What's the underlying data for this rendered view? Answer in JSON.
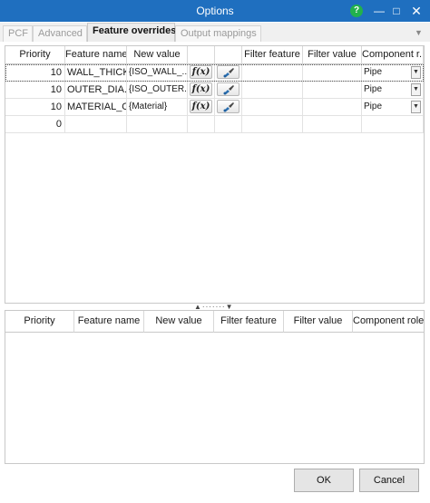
{
  "window": {
    "title": "Options"
  },
  "tabs": [
    "PCF",
    "Advanced",
    "Feature overrides",
    "Output mappings"
  ],
  "top_grid": {
    "columns": [
      "Priority",
      "Feature name",
      "New value",
      "",
      "",
      "Filter feature",
      "Filter value",
      "Component r..."
    ],
    "rows": [
      {
        "priority": "10",
        "feature_name": "WALL_THICK...",
        "new_value": "{ISO_WALL_...",
        "component": "Pipe"
      },
      {
        "priority": "10",
        "feature_name": "OUTER_DIA...",
        "new_value": "{ISO_OUTER...",
        "component": "Pipe"
      },
      {
        "priority": "10",
        "feature_name": "MATERIAL_O...",
        "new_value": "{Material}",
        "component": "Pipe"
      },
      {
        "priority": "0",
        "feature_name": "",
        "new_value": "",
        "component": ""
      }
    ],
    "expression_icon_text": "f(x)",
    "brush_icon": "paint-brush-icon"
  },
  "bottom_grid": {
    "columns": [
      "Priority",
      "Feature name",
      "New value",
      "Filter feature",
      "Filter value",
      "Component role"
    ]
  },
  "buttons": {
    "ok": "OK",
    "cancel": "Cancel"
  },
  "colors": {
    "titlebar": "#1f6fbf",
    "help": "#22b14c"
  }
}
